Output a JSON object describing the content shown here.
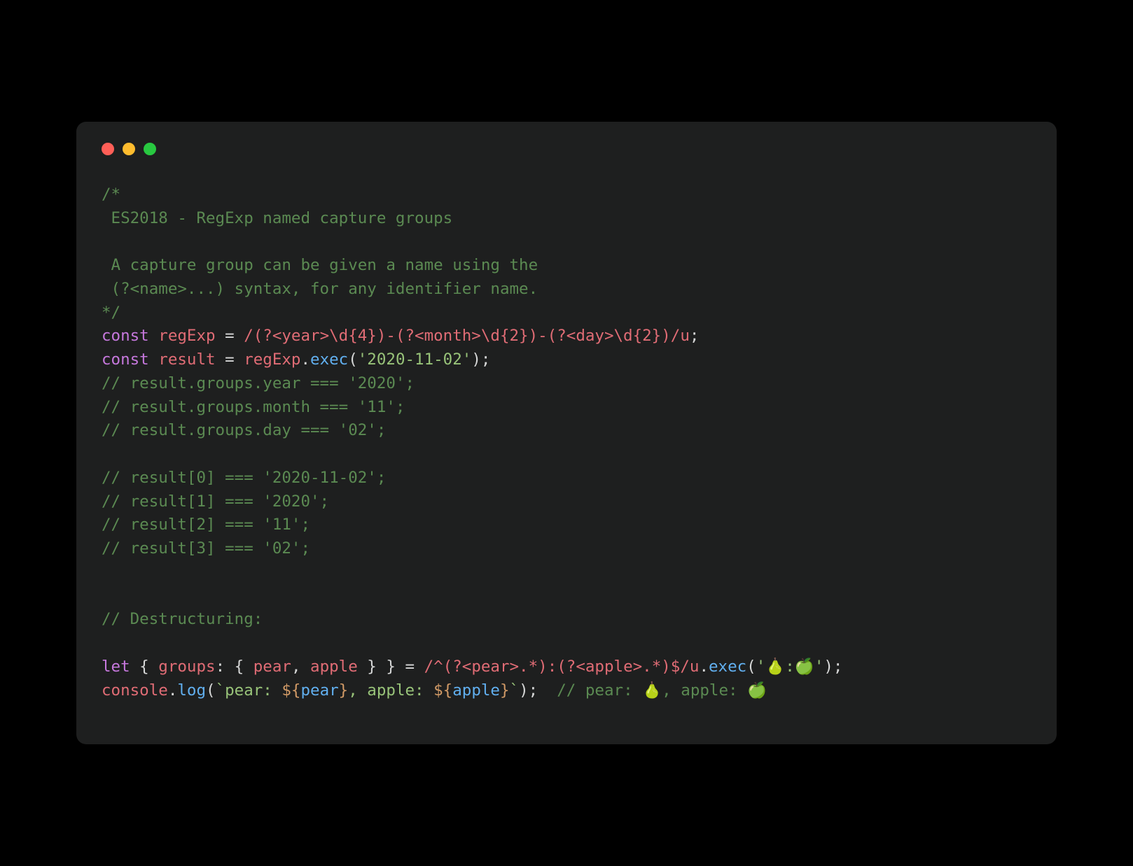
{
  "colors": {
    "bg_page": "#000000",
    "bg_window": "#1e1f1f",
    "traffic_close": "#ff5f57",
    "traffic_min": "#febc2e",
    "traffic_max": "#28c840",
    "comment": "#5b8a52",
    "keyword": "#c678dd",
    "ident": "#e06c75",
    "func": "#61afef",
    "string": "#98c379",
    "number": "#d19a66",
    "regex": "#e06c75",
    "plain": "#d6d7d7"
  },
  "code": {
    "comment_block": {
      "open": "/*",
      "l1": " ES2018 - RegExp named capture groups",
      "blank": "",
      "l2": " A capture group can be given a name using the",
      "l3": " (?<name>...) syntax, for any identifier name.",
      "close": "*/"
    },
    "decl1": {
      "kw": "const",
      "name": "regExp",
      "eq": " = ",
      "regex": "/(?<year>\\d{4})-(?<month>\\d{2})-(?<day>\\d{2})/u",
      "end": ";"
    },
    "decl2": {
      "kw": "const",
      "name": "result",
      "eq": " = ",
      "obj": "regExp",
      "dot": ".",
      "fn": "exec",
      "op": "(",
      "arg": "'2020-11-02'",
      "cp": ");"
    },
    "c_groups_year": "// result.groups.year === '2020';",
    "c_groups_month": "// result.groups.month === '11';",
    "c_groups_day": "// result.groups.day === '02';",
    "c_idx0": "// result[0] === '2020-11-02';",
    "c_idx1": "// result[1] === '2020';",
    "c_idx2": "// result[2] === '11';",
    "c_idx3": "// result[3] === '02';",
    "c_destruct_hdr": "// Destructuring:",
    "destruct": {
      "kw": "let",
      "open": " { ",
      "groups_key": "groups",
      "colon": ": { ",
      "pear": "pear",
      "comma": ", ",
      "apple": "apple",
      "close": " } } = ",
      "regex": "/^(?<pear>.*):(?<apple>.*)$/u",
      "dot": ".",
      "fn": "exec",
      "op": "(",
      "arg": "'🍐:🍏'",
      "cp": ");"
    },
    "log": {
      "obj": "console",
      "dot": ".",
      "fn": "log",
      "op": "(",
      "tmpl_open": "`pear: ",
      "int_open1": "${",
      "pear_var": "pear",
      "int_close1": "}",
      "mid": ", apple: ",
      "int_open2": "${",
      "apple_var": "apple",
      "int_close2": "}",
      "tmpl_close": "`",
      "cp": ");",
      "spacer": "  ",
      "trail_comment": "// pear: 🍐, apple: 🍏"
    }
  }
}
